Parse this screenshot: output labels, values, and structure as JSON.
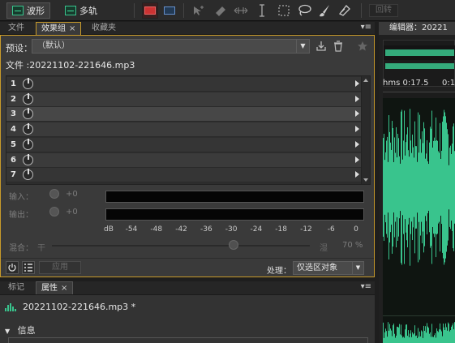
{
  "toolbar": {
    "waveform_label": "波形",
    "multitrack_label": "多轨",
    "right_button_label": "回转"
  },
  "left_tabs": {
    "file": "文件",
    "effects_rack": "效果组",
    "favorites": "收藏夹",
    "close_glyph": "×",
    "menu_glyph": "▾≡"
  },
  "effects_rack": {
    "preset_label": "预设：",
    "preset_value": "（默认）",
    "file_label": "文件 :20221102-221646.mp3",
    "slots": [
      "1",
      "2",
      "3",
      "4",
      "5",
      "6",
      "7"
    ],
    "selected_slot": 3,
    "input_label": "输入：",
    "input_value": "+0",
    "output_label": "输出：",
    "output_value": "+0",
    "meter_unit": "dB",
    "meter_ticks": [
      "-54",
      "-48",
      "-42",
      "-36",
      "-30",
      "-24",
      "-18",
      "-12",
      "-6",
      "0"
    ],
    "mix_label": "混合：",
    "mix_dry": "干",
    "mix_wet": "湿",
    "mix_value": "70 %",
    "mix_fraction": 0.7,
    "apply_label": "应用",
    "process_label": "处理：",
    "process_value": "仅选区对象"
  },
  "lower_tabs": {
    "markers": "标记",
    "properties": "属性",
    "close_glyph": "×",
    "menu_glyph": "▾≡"
  },
  "properties": {
    "filename": "20221102-221646.mp3 *",
    "info_label": "信息"
  },
  "editor": {
    "tab_label": "编辑器：20221",
    "timecode": "hms 0:17.5",
    "timecode_next": "0:1"
  },
  "colors": {
    "accent_gold": "#c79a2a",
    "waveform_green": "#39c48d"
  }
}
